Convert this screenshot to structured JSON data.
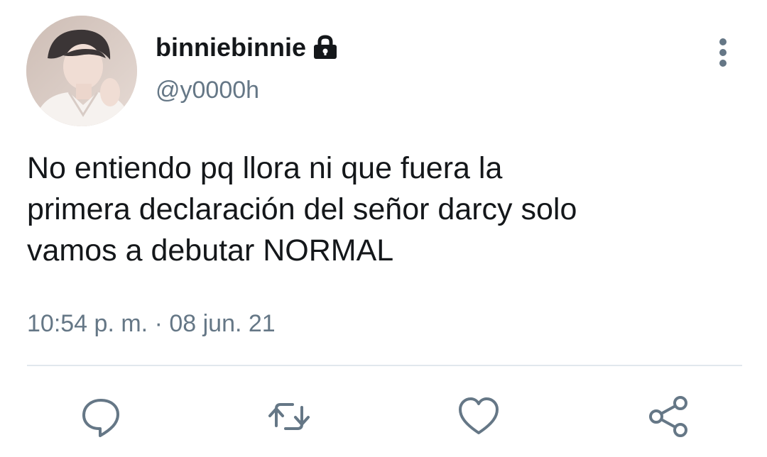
{
  "tweet": {
    "display_name": "binniebinnie",
    "handle": "@y0000h",
    "text": "No entiendo pq llora ni que fuera la\nprimera declaración del señor darcy solo\nvamos a debutar NORMAL",
    "time": "10:54 p. m.",
    "separator": "·",
    "date": "08 jun. 21",
    "protected": true
  },
  "icons": {
    "lock": "lock-icon",
    "more": "more-vertical-icon",
    "reply": "reply-icon",
    "retweet": "retweet-icon",
    "like": "heart-icon",
    "share": "share-icon"
  },
  "colors": {
    "text": "#14171a",
    "secondary": "#657786",
    "icon": "#657786",
    "divider": "#e1e8ed"
  }
}
